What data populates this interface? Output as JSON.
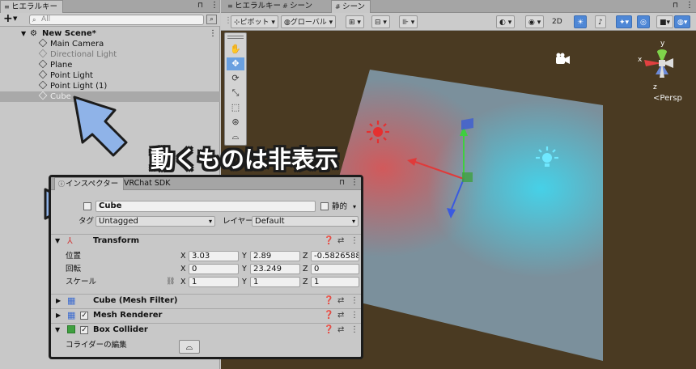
{
  "hierarchy": {
    "tab_label": "ヒエラルキー",
    "add_label": "+",
    "search_placeholder": "All",
    "scene_name": "New Scene*",
    "items": [
      {
        "label": "Main Camera"
      },
      {
        "label": "Directional Light"
      },
      {
        "label": "Plane"
      },
      {
        "label": "Point Light"
      },
      {
        "label": "Point Light (1)"
      },
      {
        "label": "Cube"
      }
    ]
  },
  "scene": {
    "tabs": [
      "ヒエラルキー",
      "シーン",
      "シーン"
    ],
    "toolbar": {
      "pivot": "ピボット",
      "global": "グローバル",
      "mode_2d": "2D"
    },
    "persp_label": "Persp",
    "gizmo_axes": {
      "x": "x",
      "y": "y",
      "z": "z"
    }
  },
  "annotation": {
    "caption": "動くものは非表示"
  },
  "inspector": {
    "tabs": [
      "インスペクター",
      "VRChat SDK"
    ],
    "object_name": "Cube",
    "static_label": "静的",
    "tag_label": "タグ",
    "tag_value": "Untagged",
    "layer_label": "レイヤー",
    "layer_value": "Default",
    "transform": {
      "title": "Transform",
      "position_label": "位置",
      "rotation_label": "回転",
      "scale_label": "スケール",
      "position": {
        "x": "3.03",
        "y": "2.89",
        "z": "-0.5826588"
      },
      "rotation": {
        "x": "0",
        "y": "23.249",
        "z": "0"
      },
      "scale": {
        "x": "1",
        "y": "1",
        "z": "1"
      }
    },
    "components": {
      "mesh_filter": "Cube (Mesh Filter)",
      "mesh_renderer": "Mesh Renderer",
      "box_collider": "Box Collider",
      "collider_edit_label": "コライダーの編集"
    }
  },
  "colors": {
    "accent_blue": "#4e87d6",
    "arrow_blue": "#8fb3e8",
    "scene_bg": "#4a3a22",
    "plane": "#7d95a4",
    "red_light": "#e03030",
    "cyan_light": "#40d8f0"
  }
}
